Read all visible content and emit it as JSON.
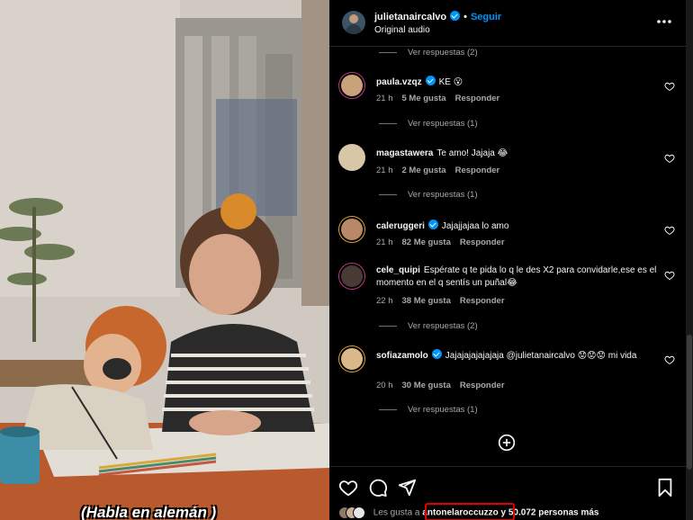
{
  "header": {
    "username": "julietanaircalvo",
    "separator": "•",
    "follow_label": "Seguir",
    "audio": "Original audio"
  },
  "top_replies": "Ver respuestas (2)",
  "comments": [
    {
      "user": "paula.vzqz",
      "verified": true,
      "text": "KE 😮",
      "time": "21 h",
      "likes": "5 Me gusta",
      "reply": "Responder",
      "replies": "Ver respuestas (1)"
    },
    {
      "user": "magastawera",
      "verified": false,
      "text": "Te amo! Jajaja 😂",
      "time": "21 h",
      "likes": "2 Me gusta",
      "reply": "Responder",
      "replies": "Ver respuestas (1)"
    },
    {
      "user": "caleruggeri",
      "verified": true,
      "text": "Jajajjajaa lo amo",
      "time": "21 h",
      "likes": "82 Me gusta",
      "reply": "Responder",
      "replies": ""
    },
    {
      "user": "cele_quipi",
      "verified": false,
      "text": "Espérate q te pida lo q le des X2 para convidarle,ese es el momento en el q sentís un puñal😂",
      "time": "22 h",
      "likes": "38 Me gusta",
      "reply": "Responder",
      "replies": "Ver respuestas (2)"
    },
    {
      "user": "sofiazamolo",
      "verified": true,
      "text": "Jajajajajajajaja @julietanaircalvo 😟😟😟 mi vida",
      "time": "20 h",
      "likes": "30 Me gusta",
      "reply": "Responder",
      "replies": "Ver respuestas (1)"
    }
  ],
  "footer": {
    "likes_prefix": "Les gusta a",
    "likes_user": "antonelaroccuzzo",
    "likes_suffix": "y 50.072 personas más"
  },
  "media": {
    "caption": "(Habla en alemán )"
  },
  "icons": {
    "more": "more-options-icon",
    "heart": "heart-icon",
    "add": "add-circle-icon",
    "comment": "comment-icon",
    "share": "share-icon",
    "save": "bookmark-icon"
  },
  "colors": {
    "accent": "#0095f6",
    "highlight": "#e00000",
    "secondary_text": "#a8a8a8"
  }
}
